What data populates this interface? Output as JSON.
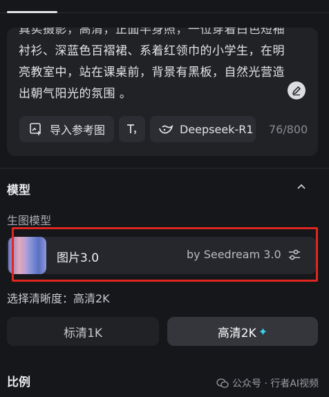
{
  "prompt": {
    "line1": "真实摄影，高清，正面半身照，一位穿着白色短袖",
    "line2": "衬衫、深蓝色百褶裙、系着红领巾的小学生，在明",
    "line3": "亮教室中，站在课桌前，背景有黑板，自然光营造",
    "line4": "出朝气阳光的氛围 。",
    "reference_button": "导入参考图",
    "model_chip": "Deepseek-R1",
    "char_count": "76/800"
  },
  "model_section": {
    "title": "模型",
    "sub_label": "生图模型",
    "model_name": "图片3.0",
    "model_by": "by Seedream 3.0"
  },
  "resolution": {
    "label": "选择清晰度：高清2K",
    "option_1k": "标清1K",
    "option_2k": "高清2K",
    "selected": "高清2K"
  },
  "ratio_section": {
    "title": "比例"
  },
  "watermark": {
    "text": "公众号 · 行者AI视频"
  },
  "colors": {
    "highlight": "#e0271f",
    "sparkle": "#37d6f0",
    "background": "#16171b"
  },
  "icons": [
    "image-import-icon",
    "text-format-icon",
    "deepseek-whale-icon",
    "edit-pen-icon",
    "chevron-up-icon",
    "settings-sliders-icon",
    "sparkle-icon",
    "wechat-icon"
  ]
}
